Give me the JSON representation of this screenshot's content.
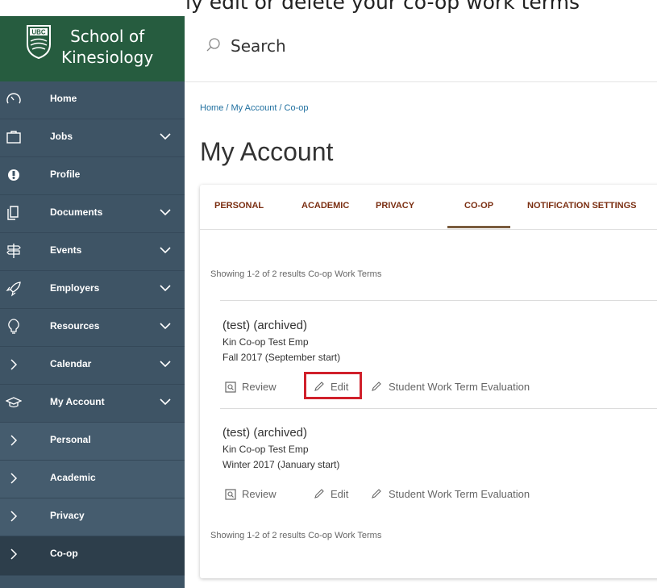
{
  "caption": {
    "text": "ly edit or delete your co-op work terms"
  },
  "header": {
    "school_name_line1": "School of",
    "school_name_line2": "Kinesiology",
    "search_placeholder": "Search"
  },
  "sidebar": {
    "items": [
      {
        "label": "Home",
        "icon": "speedometer-icon"
      },
      {
        "label": "Jobs",
        "icon": "briefcase-icon"
      },
      {
        "label": "Profile",
        "icon": "profile-icon"
      },
      {
        "label": "Documents",
        "icon": "documents-icon"
      },
      {
        "label": "Events",
        "icon": "signpost-icon"
      },
      {
        "label": "Employers",
        "icon": "rocket-icon"
      },
      {
        "label": "Resources",
        "icon": "lightbulb-icon"
      },
      {
        "label": "Calendar",
        "icon": "chevron-right-icon"
      },
      {
        "label": "My Account",
        "icon": "graduation-cap-icon"
      },
      {
        "label": "Personal",
        "icon": "chevron-right-icon"
      },
      {
        "label": "Academic",
        "icon": "chevron-right-icon"
      },
      {
        "label": "Privacy",
        "icon": "chevron-right-icon"
      },
      {
        "label": "Co-op",
        "icon": "chevron-right-icon"
      }
    ]
  },
  "breadcrumb": {
    "text": "Home / My Account / Co-op"
  },
  "page_title": "My Account",
  "tabs": [
    "PERSONAL",
    "ACADEMIC",
    "PRIVACY",
    "CO-OP",
    "NOTIFICATION SETTINGS"
  ],
  "active_tab": "CO-OP",
  "results_text": "Showing 1-2 of 2 results  Co-op Work Terms",
  "work_terms": [
    {
      "title": "(test) (archived)",
      "employer": "Kin Co-op Test Emp",
      "term": "Fall 2017 (September start)"
    },
    {
      "title": "(test) (archived)",
      "employer": "Kin Co-op Test Emp",
      "term": "Winter 2017 (January start)"
    }
  ],
  "actions": {
    "review": "Review",
    "edit": "Edit",
    "evaluation": "Student Work Term Evaluation"
  },
  "colors": {
    "brand_green": "#265c3f",
    "sidebar": "#3e5465",
    "highlight": "#d0202b",
    "tab_text": "#7b2f12"
  }
}
